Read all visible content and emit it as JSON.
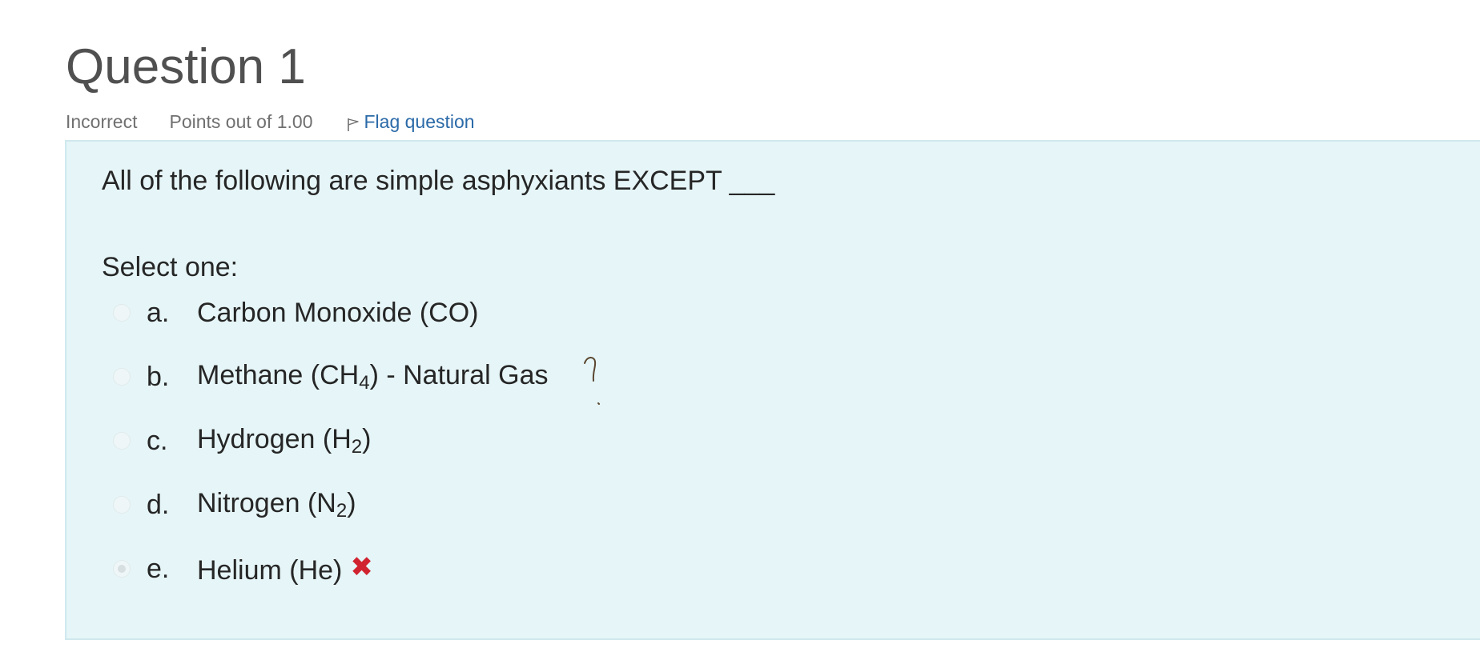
{
  "question": {
    "title": "Question 1",
    "state": "Incorrect",
    "grade": "Points out of 1.00",
    "flag_label": "Flag question",
    "text": "All of the following are simple asphyxiants EXCEPT ___",
    "prompt": "Select one:"
  },
  "answers": [
    {
      "letter": "a.",
      "text": "Carbon Monoxide (CO)",
      "checked": false
    },
    {
      "letter": "b.",
      "pre": "Methane (CH",
      "sub": "4",
      "post": ") - Natural Gas",
      "checked": false
    },
    {
      "letter": "c.",
      "pre": "Hydrogen (H",
      "sub": "2",
      "post": ")",
      "checked": false
    },
    {
      "letter": "d.",
      "pre": "Nitrogen (N",
      "sub": "2",
      "post": ")",
      "checked": false
    },
    {
      "letter": "e.",
      "text": "Helium (He)",
      "checked": true,
      "feedback_icon": "incorrect-x-icon"
    }
  ],
  "colors": {
    "box_background": "#e6f5f7",
    "link": "#2b6aa8",
    "incorrect": "#d0232f"
  }
}
